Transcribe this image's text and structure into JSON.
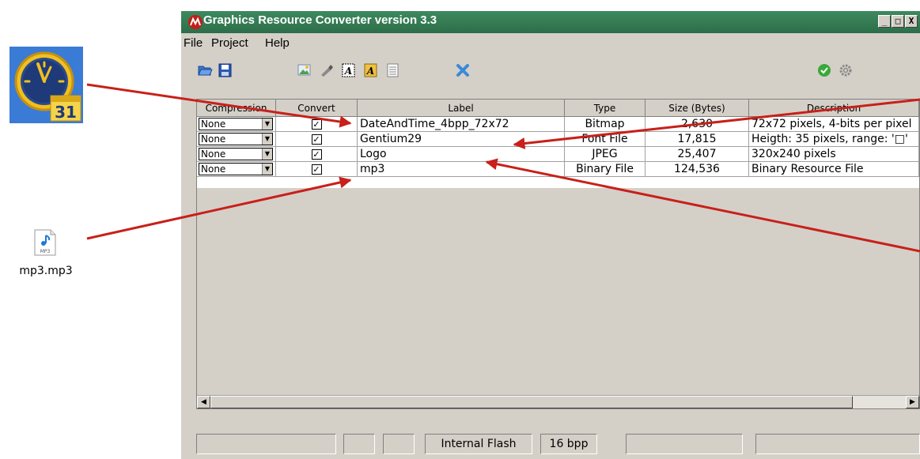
{
  "window": {
    "title": "Graphics Resource Converter version 3.3",
    "controls": [
      "_",
      "□",
      "X"
    ]
  },
  "menu": [
    "File",
    "Project",
    "Help"
  ],
  "grid": {
    "columns": [
      "Compression",
      "Convert",
      "Label",
      "Type",
      "Size (Bytes)",
      "Description"
    ],
    "rows": [
      {
        "compression": "None",
        "convert": "✓",
        "label": "DateAndTime_4bpp_72x72",
        "type": "Bitmap",
        "size": "2,630",
        "description": "72x72 pixels, 4-bits per pixel"
      },
      {
        "compression": "None",
        "convert": "✓",
        "label": "Gentium29",
        "type": "Font File",
        "size": "17,815",
        "description": "Heigth: 35 pixels, range: '□'"
      },
      {
        "compression": "None",
        "convert": "✓",
        "label": "Logo",
        "type": "JPEG",
        "size": "25,407",
        "description": "320x240 pixels"
      },
      {
        "compression": "None",
        "convert": "✓",
        "label": "mp3",
        "type": "Binary File",
        "size": "124,536",
        "description": "Binary Resource File"
      }
    ]
  },
  "status": [
    "",
    "",
    "",
    "Internal Flash",
    "16 bpp",
    "",
    ""
  ],
  "desktop": {
    "calendar_day": "31",
    "mp3_badge": "MP3",
    "mp3_label": "mp3.mp3"
  },
  "colors": {
    "title_bar": "#2d6d4a",
    "window_face": "#d4d0c8",
    "arrow": "#c8201a",
    "logo_red": "#c0201a"
  }
}
